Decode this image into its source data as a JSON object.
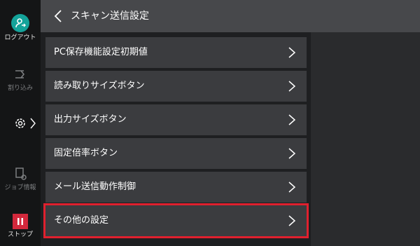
{
  "header": {
    "title": "スキャン送信設定"
  },
  "sidebar": {
    "logout_label": "ログアウト",
    "interrupt_label": "割り込み",
    "job_info_label": "ジョブ情報",
    "stop_label": "ストップ"
  },
  "menu": {
    "items": [
      {
        "label": "PC保存機能設定初期値"
      },
      {
        "label": "読み取りサイズボタン"
      },
      {
        "label": "出力サイズボタン"
      },
      {
        "label": "固定倍率ボタン"
      },
      {
        "label": "メール送信動作制御"
      },
      {
        "label": "その他の設定"
      }
    ],
    "selected_index": 5
  },
  "colors": {
    "accent_teal": "#14a39a",
    "stop_red": "#d3283c",
    "selection_red": "#e0202e"
  }
}
